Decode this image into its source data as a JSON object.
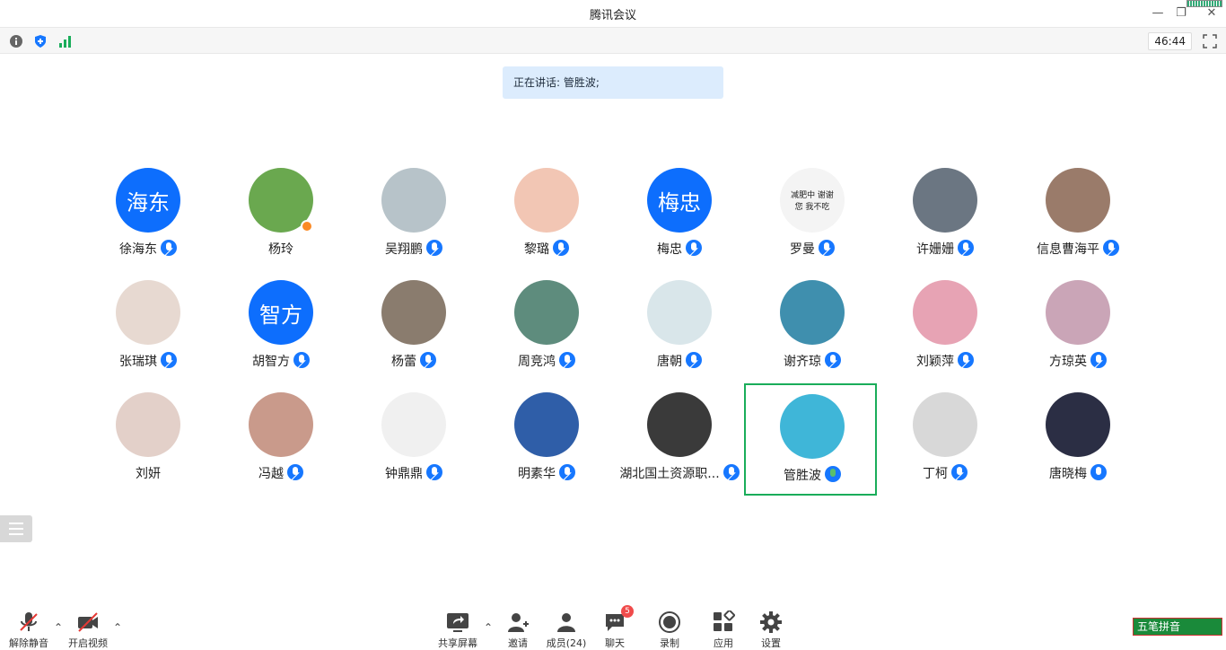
{
  "window": {
    "title": "腾讯会议"
  },
  "top_toolbar": {
    "timer": "46:44"
  },
  "speaking_banner": "正在讲话: 管胜波;",
  "participants": [
    {
      "name": "徐海东",
      "avatar_text": "海东",
      "avatar_color": "#0d6efd"
    },
    {
      "name": "杨玲",
      "avatar_color": "#6aa84f"
    },
    {
      "name": "吴翔鹏",
      "avatar_color": "#b7c3c9"
    },
    {
      "name": "黎璐",
      "avatar_color": "#f2c6b4"
    },
    {
      "name": "梅忠",
      "avatar_text": "梅忠",
      "avatar_color": "#0d6efd"
    },
    {
      "name": "罗曼",
      "avatar_color": "#f4f4f4",
      "avatar_caption": "减肥中 谢谢您 我不吃"
    },
    {
      "name": "许姗姗",
      "avatar_color": "#6b7682"
    },
    {
      "name": "信息曹海平",
      "avatar_color": "#9a7b6a"
    },
    {
      "name": "张瑞琪",
      "avatar_color": "#e7d9d1"
    },
    {
      "name": "胡智方",
      "avatar_text": "智方",
      "avatar_color": "#0d6efd"
    },
    {
      "name": "杨蕾",
      "avatar_color": "#8a7c6e"
    },
    {
      "name": "周竞鸿",
      "avatar_color": "#5e8c7d"
    },
    {
      "name": "唐朝",
      "avatar_color": "#d9e6ea"
    },
    {
      "name": "谢齐琼",
      "avatar_color": "#3f8fae"
    },
    {
      "name": "刘颖萍",
      "avatar_color": "#e7a3b4"
    },
    {
      "name": "方琼英",
      "avatar_color": "#caa5b7"
    },
    {
      "name": "刘妍",
      "avatar_color": "#e3d0c9"
    },
    {
      "name": "冯越",
      "avatar_color": "#c99a8b"
    },
    {
      "name": "钟鼎鼎",
      "avatar_color": "#f0f0f0"
    },
    {
      "name": "明素华",
      "avatar_color": "#2f5ea8"
    },
    {
      "name": "湖北国土资源职...",
      "avatar_color": "#3a3a3a"
    },
    {
      "name": "管胜波",
      "avatar_color": "#3fb6d8"
    },
    {
      "name": "丁柯",
      "avatar_color": "#d8d8d8"
    },
    {
      "name": "唐晓梅",
      "avatar_color": "#2b2e44"
    }
  ],
  "bottom_toolbar": {
    "unmute": "解除静音",
    "start_video": "开启视频",
    "share_screen": "共享屏幕",
    "invite": "邀请",
    "members": "成员(24)",
    "chat": "聊天",
    "chat_unread": "5",
    "record": "录制",
    "apps": "应用",
    "settings": "设置"
  },
  "ime": {
    "label": "五笔拼音"
  }
}
